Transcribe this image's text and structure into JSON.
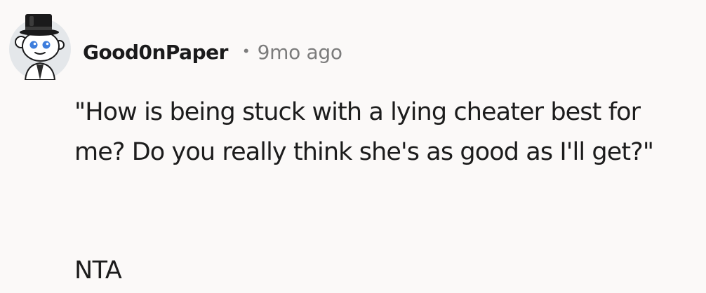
{
  "comment": {
    "username": "Good0nPaper",
    "separator": "•",
    "timestamp": "9mo ago",
    "body": "\"How is being stuck with a lying cheater best for me? Do you really think she's as good as I'll get?\"",
    "verdict": "NTA",
    "avatar_icon": "snoo-avatar-with-top-hat-icon"
  },
  "colors": {
    "background": "#fbf9f8",
    "text": "#1c1c1c",
    "meta": "#7c7c7c",
    "avatar_bg": "#e4e7ea"
  }
}
